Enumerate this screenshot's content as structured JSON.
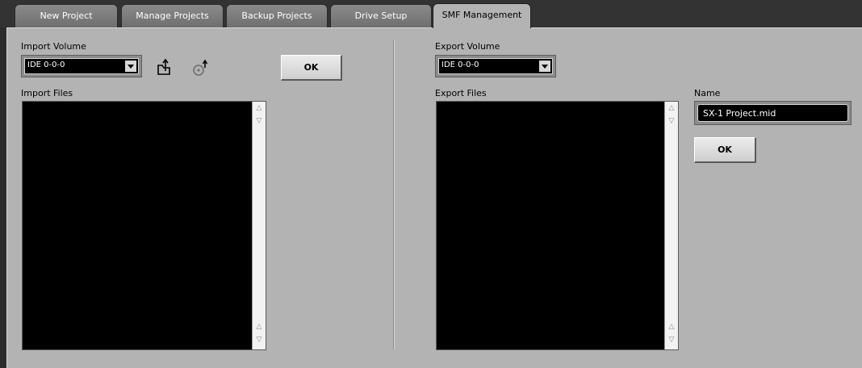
{
  "tabs": [
    {
      "label": "New Project"
    },
    {
      "label": "Manage Projects"
    },
    {
      "label": "Backup Projects"
    },
    {
      "label": "Drive Setup"
    },
    {
      "label": "SMF Management"
    }
  ],
  "active_tab": "SMF Management",
  "import": {
    "volume_label": "Import Volume",
    "volume_value": "IDE 0-0-0",
    "files_label": "Import Files",
    "ok_label": "OK",
    "icons": [
      "folder-up-icon",
      "disc-eject-icon"
    ]
  },
  "export": {
    "volume_label": "Export Volume",
    "volume_value": "IDE 0-0-0",
    "files_label": "Export Files",
    "name_label": "Name",
    "name_value": "SX-1 Project.mid",
    "ok_label": "OK"
  },
  "scroll": {
    "up_glyph": "△",
    "down_glyph": "▽"
  },
  "colors": {
    "panel_bg": "#b3b3b3",
    "tab_inactive": "#7d7d7d",
    "tab_active": "#b3b3b3",
    "list_bg": "#000000"
  }
}
